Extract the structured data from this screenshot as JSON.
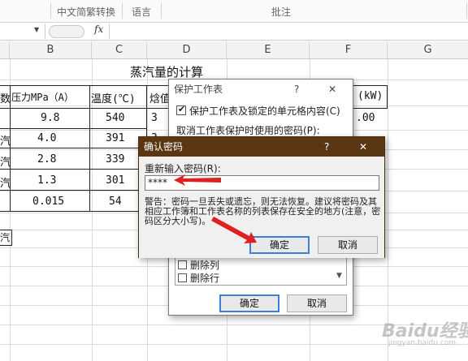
{
  "ribbon": {
    "items": [
      "中文简繁转换",
      "语言",
      "批注"
    ]
  },
  "formula_bar": {
    "name_box_value": "",
    "fx_label": "fx",
    "formula_value": ""
  },
  "grid": {
    "columns": [
      "B",
      "C",
      "D",
      "E",
      "F",
      "G"
    ],
    "title": "蒸汽量的计算",
    "headers": [
      "数",
      "压力MPa（A）",
      "温度(℃)",
      "焓值",
      "(kW)"
    ],
    "rows": [
      {
        "a": "",
        "b": "9.8",
        "c": "540",
        "d": "3",
        "f": ".00"
      },
      {
        "a": "汽",
        "b": "4.0",
        "c": "391",
        "d": "3",
        "f": ""
      },
      {
        "a": "汽",
        "b": "2.8",
        "c": "339",
        "d": "3",
        "f": ""
      },
      {
        "a": "汽",
        "b": "1.3",
        "c": "301",
        "d": "3",
        "f": ""
      },
      {
        "a": "",
        "b": "0.015",
        "c": "54",
        "d": "",
        "f": ""
      }
    ],
    "extra_cell": "汽"
  },
  "protect_dialog": {
    "title": "保护工作表",
    "help": "?",
    "close": "✕",
    "checkbox_label": "保护工作表及锁定的单元格内容(C)",
    "checkbox_checked": true,
    "password_label": "取消工作表保护时使用的密码(P):",
    "list_items": [
      {
        "label": "删除列",
        "checked": false
      },
      {
        "label": "删除行",
        "checked": false
      }
    ],
    "ok_label": "确定",
    "cancel_label": "取消"
  },
  "confirm_dialog": {
    "title": "确认密码",
    "help": "?",
    "close": "✕",
    "reenter_label": "重新输入密码(R):",
    "password_value": "****",
    "warning": "警告：密码一旦丢失或遗忘，则无法恢复。建议将密码及其相应工作簿和工作表名称的列表保存在安全的地方(注意，密码区分大小写)。",
    "ok_label": "确定",
    "cancel_label": "取消"
  },
  "watermark": {
    "text": "Baidu经验",
    "sub": "jingyan.baidu.com"
  },
  "colors": {
    "title_bar_brown": "#5a3712",
    "arrow_red": "#e02020",
    "default_button_border": "#3c7fd6"
  }
}
